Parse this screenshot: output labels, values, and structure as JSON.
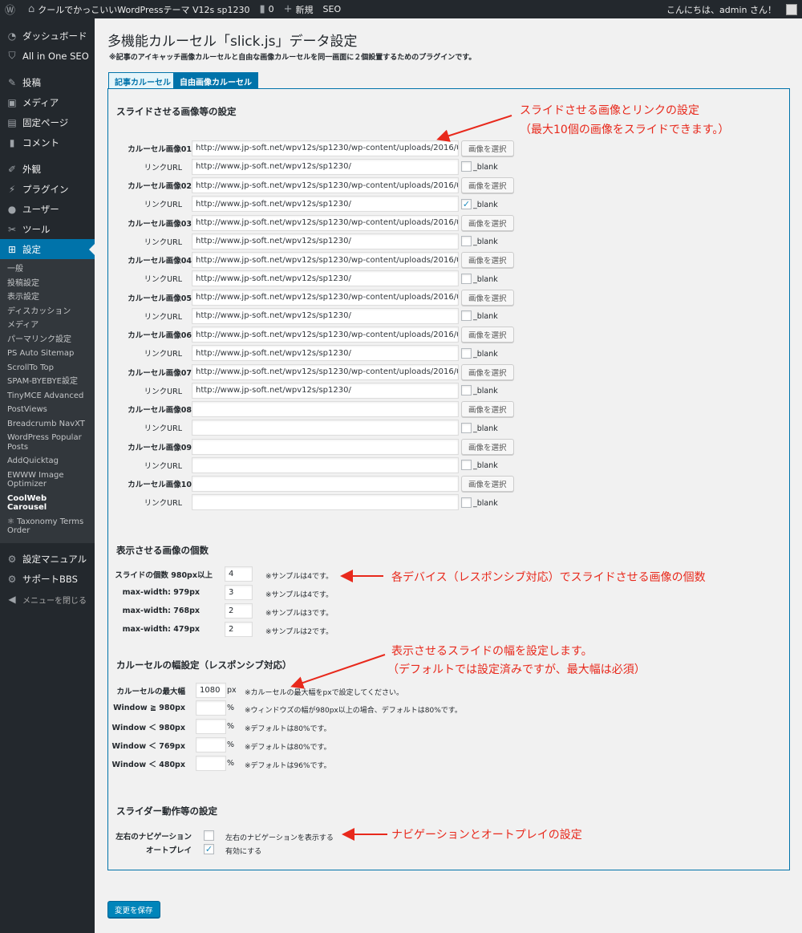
{
  "adminbar": {
    "site_name": "クールでかっこいいWordPressテーマ V12s sp1230",
    "comments": "0",
    "new": "新規",
    "seo": "SEO",
    "greeting": "こんにちは、admin さん！"
  },
  "sidebar": {
    "items": [
      {
        "label": "ダッシュボード",
        "icon": "dashboard-icon"
      },
      {
        "label": "All in One SEO",
        "icon": "seo-icon"
      },
      {
        "label": "投稿",
        "icon": "pin-icon"
      },
      {
        "label": "メディア",
        "icon": "media-icon"
      },
      {
        "label": "固定ページ",
        "icon": "page-icon"
      },
      {
        "label": "コメント",
        "icon": "comment-icon"
      },
      {
        "label": "外観",
        "icon": "brush-icon"
      },
      {
        "label": "プラグイン",
        "icon": "plugin-icon"
      },
      {
        "label": "ユーザー",
        "icon": "user-icon"
      },
      {
        "label": "ツール",
        "icon": "wrench-icon"
      },
      {
        "label": "設定",
        "icon": "settings-icon"
      }
    ],
    "submenu": [
      "一般",
      "投稿設定",
      "表示設定",
      "ディスカッション",
      "メディア",
      "パーマリンク設定",
      "PS Auto Sitemap",
      "ScrollTo Top",
      "SPAM-BYEBYE設定",
      "TinyMCE Advanced",
      "PostViews",
      "Breadcrumb NavXT",
      "WordPress Popular Posts",
      "AddQuicktag",
      "EWWW Image Optimizer",
      "CoolWeb Carousel",
      "Taxonomy Terms Order"
    ],
    "bottom": [
      {
        "label": "設定マニュアル",
        "icon": "gear-icon"
      },
      {
        "label": "サポートBBS",
        "icon": "gear-icon"
      },
      {
        "label": "メニューを閉じる",
        "icon": "collapse-icon"
      }
    ]
  },
  "page": {
    "title": "多機能カルーセル「slick.js」データ設定",
    "desc": "※記事のアイキャッチ画像カルーセルと自由な画像カルーセルを同一画面に２個設置するためのプラグインです。",
    "tabs": [
      "記事カルーセル",
      "自由画像カルーセル"
    ],
    "save": "変更を保存"
  },
  "images_section": {
    "title": "スライドさせる画像等の設定",
    "select_label": "画像を選択",
    "url_label": "リンクURL",
    "blank_label": "_blank",
    "rows": [
      {
        "label": "カルーセル画像01",
        "image": "http://www.jp-soft.net/wpv12s/sp1230/wp-content/uploads/2016/0",
        "link": "http://www.jp-soft.net/wpv12s/sp1230/",
        "blank": ""
      },
      {
        "label": "カルーセル画像02",
        "image": "http://www.jp-soft.net/wpv12s/sp1230/wp-content/uploads/2016/0",
        "link": "http://www.jp-soft.net/wpv12s/sp1230/",
        "blank": "✓"
      },
      {
        "label": "カルーセル画像03",
        "image": "http://www.jp-soft.net/wpv12s/sp1230/wp-content/uploads/2016/0",
        "link": "http://www.jp-soft.net/wpv12s/sp1230/",
        "blank": ""
      },
      {
        "label": "カルーセル画像04",
        "image": "http://www.jp-soft.net/wpv12s/sp1230/wp-content/uploads/2016/0",
        "link": "http://www.jp-soft.net/wpv12s/sp1230/",
        "blank": ""
      },
      {
        "label": "カルーセル画像05",
        "image": "http://www.jp-soft.net/wpv12s/sp1230/wp-content/uploads/2016/0",
        "link": "http://www.jp-soft.net/wpv12s/sp1230/",
        "blank": ""
      },
      {
        "label": "カルーセル画像06",
        "image": "http://www.jp-soft.net/wpv12s/sp1230/wp-content/uploads/2016/0",
        "link": "http://www.jp-soft.net/wpv12s/sp1230/",
        "blank": ""
      },
      {
        "label": "カルーセル画像07",
        "image": "http://www.jp-soft.net/wpv12s/sp1230/wp-content/uploads/2016/0",
        "link": "http://www.jp-soft.net/wpv12s/sp1230/",
        "blank": ""
      },
      {
        "label": "カルーセル画像08",
        "image": "",
        "link": "",
        "blank": ""
      },
      {
        "label": "カルーセル画像09",
        "image": "",
        "link": "",
        "blank": ""
      },
      {
        "label": "カルーセル画像10",
        "image": "",
        "link": "",
        "blank": ""
      }
    ]
  },
  "count_section": {
    "title": "表示させる画像の個数",
    "rows": [
      {
        "label": "スライドの個数 980px以上",
        "value": "4",
        "note": "※サンプルは4です。"
      },
      {
        "label": "max-width: 979px",
        "value": "3",
        "note": "※サンプルは4です。"
      },
      {
        "label": "max-width: 768px",
        "value": "2",
        "note": "※サンプルは3です。"
      },
      {
        "label": "max-width: 479px",
        "value": "2",
        "note": "※サンプルは2です。"
      }
    ]
  },
  "width_section": {
    "title": "カルーセルの幅設定（レスポンシブ対応）",
    "max_label": "カルーセルの最大幅",
    "max_value": "1080",
    "max_unit": "px",
    "max_note": "※カルーセルの最大幅をpxで設定してください。",
    "rows": [
      {
        "label": "Window ≧ 980px",
        "value": "",
        "unit": "%",
        "note": "※ウィンドウズの幅が980px以上の場合、デフォルトは80%です。"
      },
      {
        "label": "Window ＜ 980px",
        "value": "",
        "unit": "%",
        "note": "※デフォルトは80%です。"
      },
      {
        "label": "Window ＜ 769px",
        "value": "",
        "unit": "%",
        "note": "※デフォルトは80%です。"
      },
      {
        "label": "Window ＜ 480px",
        "value": "",
        "unit": "%",
        "note": "※デフォルトは96%です。"
      }
    ]
  },
  "slider_section": {
    "title": "スライダー動作等の設定",
    "nav_label": "左右のナビゲーション",
    "nav_checked": "",
    "nav_text": "左右のナビゲーションを表示する",
    "autoplay_label": "オートプレイ",
    "autoplay_checked": "✓",
    "autoplay_text": "有効にする"
  },
  "annotations": {
    "a1_line1": "スライドさせる画像とリンクの設定",
    "a1_line2": "（最大10個の画像をスライドできます。）",
    "a2": "各デバイス（レスポンシブ対応）でスライドさせる画像の個数",
    "a3_line1": "表示させるスライドの幅を設定します。",
    "a3_line2": "（デフォルトでは設定済みですが、最大幅は必須）",
    "a4": "ナビゲーションとオートプレイの設定"
  },
  "colors": {
    "accent": "#0073aa",
    "annotation": "#e8291c",
    "sidebar": "#23282d"
  }
}
